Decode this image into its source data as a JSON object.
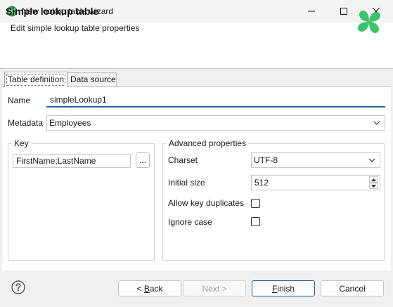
{
  "window": {
    "title": "New lookup table wizard",
    "icon": "clover-icon",
    "controls": [
      "minimize-icon",
      "maximize-icon",
      "close-icon"
    ]
  },
  "header": {
    "title": "Simple lookup table",
    "subtitle": "Edit simple lookup table properties",
    "logo": "clover-logo",
    "logo_color": "#3cc36b"
  },
  "tabs": [
    {
      "label": "Table definition",
      "selected": true
    },
    {
      "label": "Data source",
      "selected": false
    }
  ],
  "form": {
    "name_label": "Name",
    "name_value": "simpleLookup1",
    "metadata_label": "Metadata",
    "metadata_value": "Employees"
  },
  "key_group": {
    "legend": "Key",
    "value": "FirstName;LastName",
    "browse_label": "..."
  },
  "advanced": {
    "legend": "Advanced properties",
    "charset_label": "Charset",
    "charset_value": "UTF-8",
    "initial_size_label": "Initial size",
    "initial_size_value": "512",
    "allow_dup_label": "Allow key duplicates",
    "allow_dup_checked": false,
    "ignore_case_label": "Ignore case",
    "ignore_case_checked": false
  },
  "footer": {
    "help_icon": "help-icon",
    "back_prefix": "< ",
    "back_mnemonic": "B",
    "back_rest": "ack",
    "next_label": "Next >",
    "finish_mnemonic": "F",
    "finish_rest": "inish",
    "cancel_label": "Cancel"
  },
  "colors": {
    "accent": "#1f5f99",
    "brand_green": "#3cc36b"
  }
}
